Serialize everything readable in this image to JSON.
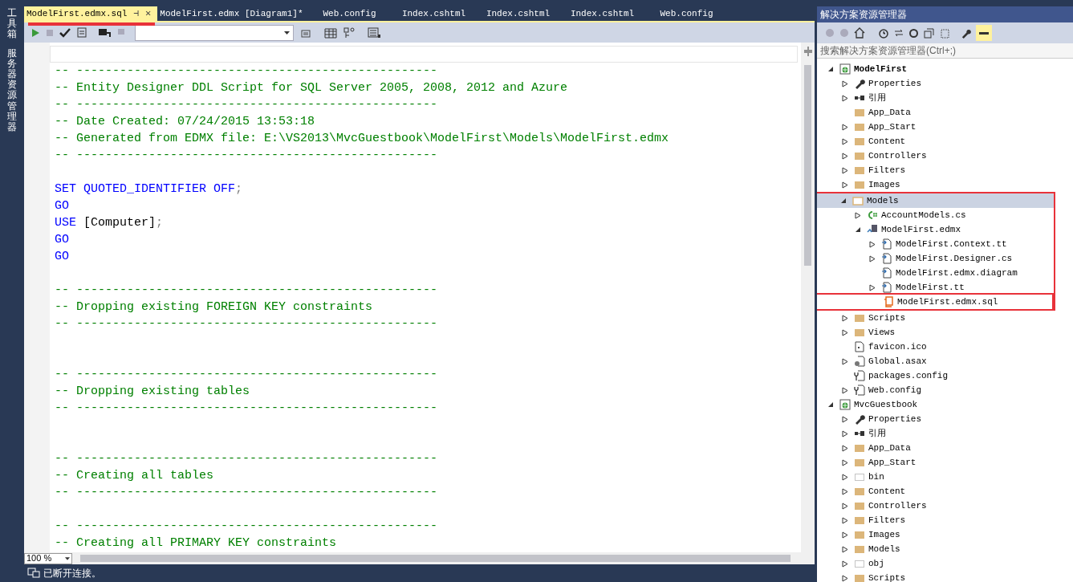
{
  "side_strip": {
    "tabs": [
      "工具箱",
      "服务器资源管理器"
    ]
  },
  "editor": {
    "tabs": [
      {
        "label": "ModelFirst.edmx.sql",
        "selected": true,
        "pin": "⊣",
        "close": "✕",
        "marked": true
      },
      {
        "label": "ModelFirst.edmx [Diagram1]*",
        "selected": false
      },
      {
        "label": "Web.config",
        "selected": false
      },
      {
        "label": "Index.cshtml",
        "selected": false
      },
      {
        "label": "Index.cshtml",
        "selected": false
      },
      {
        "label": "Index.cshtml",
        "selected": false
      },
      {
        "label": "Web.config",
        "selected": false
      }
    ],
    "lines": [
      {
        "kind": "current"
      },
      {
        "segments": [
          {
            "kind": "comment",
            "text": "-- --------------------------------------------------"
          }
        ]
      },
      {
        "segments": [
          {
            "kind": "comment",
            "text": "-- Entity Designer DDL Script for SQL Server 2005, 2008, 2012 and Azure"
          }
        ]
      },
      {
        "segments": [
          {
            "kind": "comment",
            "text": "-- --------------------------------------------------"
          }
        ]
      },
      {
        "segments": [
          {
            "kind": "comment",
            "text": "-- Date Created: 07/24/2015 13:53:18"
          }
        ]
      },
      {
        "segments": [
          {
            "kind": "comment",
            "text": "-- Generated from EDMX file: E:\\VS2013\\MvcGuestbook\\ModelFirst\\Models\\ModelFirst.edmx"
          }
        ]
      },
      {
        "segments": [
          {
            "kind": "comment",
            "text": "-- --------------------------------------------------"
          }
        ]
      },
      {
        "kind": "blank"
      },
      {
        "segments": [
          {
            "kind": "keyword",
            "text": "SET QUOTED_IDENTIFIER OFF"
          },
          {
            "kind": "punct",
            "text": ";"
          }
        ]
      },
      {
        "segments": [
          {
            "kind": "keyword",
            "text": "GO"
          }
        ]
      },
      {
        "segments": [
          {
            "kind": "keyword",
            "text": "USE"
          },
          {
            "kind": "plain",
            "text": " [Computer]"
          },
          {
            "kind": "punct",
            "text": ";"
          }
        ]
      },
      {
        "segments": [
          {
            "kind": "keyword",
            "text": "GO"
          }
        ]
      },
      {
        "segments": [
          {
            "kind": "keyword",
            "text": "GO"
          }
        ]
      },
      {
        "kind": "blank"
      },
      {
        "segments": [
          {
            "kind": "comment",
            "text": "-- --------------------------------------------------"
          }
        ]
      },
      {
        "segments": [
          {
            "kind": "comment",
            "text": "-- Dropping existing FOREIGN KEY constraints"
          }
        ]
      },
      {
        "segments": [
          {
            "kind": "comment",
            "text": "-- --------------------------------------------------"
          }
        ]
      },
      {
        "kind": "blank"
      },
      {
        "kind": "blank"
      },
      {
        "segments": [
          {
            "kind": "comment",
            "text": "-- --------------------------------------------------"
          }
        ]
      },
      {
        "segments": [
          {
            "kind": "comment",
            "text": "-- Dropping existing tables"
          }
        ]
      },
      {
        "segments": [
          {
            "kind": "comment",
            "text": "-- --------------------------------------------------"
          }
        ]
      },
      {
        "kind": "blank"
      },
      {
        "kind": "blank"
      },
      {
        "segments": [
          {
            "kind": "comment",
            "text": "-- --------------------------------------------------"
          }
        ]
      },
      {
        "segments": [
          {
            "kind": "comment",
            "text": "-- Creating all tables"
          }
        ]
      },
      {
        "segments": [
          {
            "kind": "comment",
            "text": "-- --------------------------------------------------"
          }
        ]
      },
      {
        "kind": "blank"
      },
      {
        "segments": [
          {
            "kind": "comment",
            "text": "-- --------------------------------------------------"
          }
        ]
      },
      {
        "segments": [
          {
            "kind": "comment",
            "text": "-- Creating all PRIMARY KEY constraints"
          }
        ]
      }
    ],
    "zoom": "100 %"
  },
  "status_bar": {
    "text": "已断开连接。"
  },
  "solution_explorer": {
    "title": "解决方案资源管理器",
    "search": {
      "placeholder": "搜索解决方案资源管理器(Ctrl+;)"
    },
    "tree": [
      {
        "kind": "project",
        "label": "ModelFirst",
        "bold": true,
        "expanded": true,
        "selected": false,
        "children": [
          {
            "kind": "wrench",
            "label": "Properties",
            "expanded": false,
            "selected": false
          },
          {
            "kind": "refs",
            "label": "引用",
            "expanded": false,
            "selected": false
          },
          {
            "kind": "folder",
            "label": "App_Data",
            "selected": false
          },
          {
            "kind": "folder",
            "label": "App_Start",
            "expanded": false,
            "selected": false
          },
          {
            "kind": "folder",
            "label": "Content",
            "expanded": false,
            "selected": false
          },
          {
            "kind": "folder",
            "label": "Controllers",
            "expanded": false,
            "selected": false
          },
          {
            "kind": "folder",
            "label": "Filters",
            "expanded": false,
            "selected": false
          },
          {
            "kind": "folder",
            "label": "Images",
            "expanded": false,
            "selected": false
          },
          {
            "kind": "folder-open",
            "label": "Models",
            "expanded": true,
            "selected": true,
            "marked": true,
            "children": [
              {
                "kind": "csharp",
                "label": "AccountModels.cs",
                "expanded": false,
                "selected": false
              },
              {
                "kind": "edmx",
                "label": "ModelFirst.edmx",
                "expanded": true,
                "selected": false,
                "children": [
                  {
                    "kind": "template",
                    "label": "ModelFirst.Context.tt",
                    "expanded": false,
                    "selected": false
                  },
                  {
                    "kind": "template",
                    "label": "ModelFirst.Designer.cs",
                    "expanded": false,
                    "selected": false
                  },
                  {
                    "kind": "template",
                    "label": "ModelFirst.edmx.diagram",
                    "selected": false
                  },
                  {
                    "kind": "template",
                    "label": "ModelFirst.tt",
                    "expanded": false,
                    "selected": false
                  },
                  {
                    "kind": "sql",
                    "label": "ModelFirst.edmx.sql",
                    "selected": false,
                    "marked": true
                  }
                ]
              }
            ]
          },
          {
            "kind": "folder",
            "label": "Scripts",
            "expanded": false,
            "selected": false
          },
          {
            "kind": "folder",
            "label": "Views",
            "expanded": false,
            "selected": false
          },
          {
            "kind": "ico",
            "label": "favicon.ico",
            "selected": false
          },
          {
            "kind": "asax",
            "label": "Global.asax",
            "expanded": false,
            "selected": false
          },
          {
            "kind": "config",
            "label": "packages.config",
            "selected": false
          },
          {
            "kind": "config",
            "label": "Web.config",
            "expanded": false,
            "selected": false
          }
        ]
      },
      {
        "kind": "project",
        "label": "MvcGuestbook",
        "bold": false,
        "expanded": true,
        "selected": false,
        "children": [
          {
            "kind": "wrench",
            "label": "Properties",
            "expanded": false,
            "selected": false
          },
          {
            "kind": "refs",
            "label": "引用",
            "expanded": false,
            "selected": false
          },
          {
            "kind": "folder",
            "label": "App_Data",
            "expanded": false,
            "selected": false
          },
          {
            "kind": "folder",
            "label": "App_Start",
            "expanded": false,
            "selected": false
          },
          {
            "kind": "dashed",
            "label": "bin",
            "expanded": false,
            "selected": false
          },
          {
            "kind": "folder",
            "label": "Content",
            "expanded": false,
            "selected": false
          },
          {
            "kind": "folder",
            "label": "Controllers",
            "expanded": false,
            "selected": false
          },
          {
            "kind": "folder",
            "label": "Filters",
            "expanded": false,
            "selected": false
          },
          {
            "kind": "folder",
            "label": "Images",
            "expanded": false,
            "selected": false
          },
          {
            "kind": "folder",
            "label": "Models",
            "expanded": false,
            "selected": false
          },
          {
            "kind": "dashed",
            "label": "obj",
            "expanded": false,
            "selected": false
          },
          {
            "kind": "folder",
            "label": "Scripts",
            "expanded": false,
            "selected": false
          }
        ]
      }
    ]
  }
}
